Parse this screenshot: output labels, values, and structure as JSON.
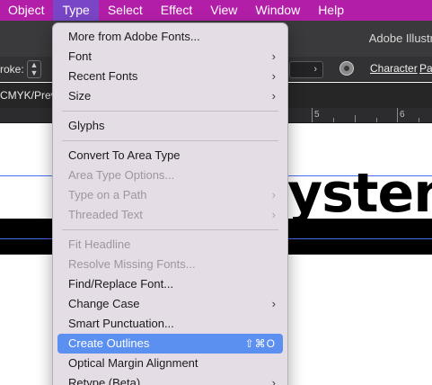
{
  "menubar": {
    "items": [
      "Object",
      "Type",
      "Select",
      "Effect",
      "View",
      "Window",
      "Help"
    ],
    "active_index": 1
  },
  "app": {
    "title": "Adobe Illustr"
  },
  "control_bar": {
    "stroke_label": "roke:",
    "char_link": "Character",
    "par_link": "Par"
  },
  "doc_tab": "CMYK/Previ",
  "ruler": {
    "labels": [
      "5",
      "6"
    ]
  },
  "canvas": {
    "text": "ysten"
  },
  "type_menu": {
    "items": [
      {
        "label": "More from Adobe Fonts...",
        "enabled": true
      },
      {
        "label": "Font",
        "enabled": true,
        "submenu": true
      },
      {
        "label": "Recent Fonts",
        "enabled": true,
        "submenu": true
      },
      {
        "label": "Size",
        "enabled": true,
        "submenu": true
      },
      {
        "separator": true
      },
      {
        "label": "Glyphs",
        "enabled": true
      },
      {
        "separator": true
      },
      {
        "label": "Convert To Area Type",
        "enabled": true
      },
      {
        "label": "Area Type Options...",
        "enabled": false
      },
      {
        "label": "Type on a Path",
        "enabled": false,
        "submenu": true
      },
      {
        "label": "Threaded Text",
        "enabled": false,
        "submenu": true
      },
      {
        "separator": true
      },
      {
        "label": "Fit Headline",
        "enabled": false
      },
      {
        "label": "Resolve Missing Fonts...",
        "enabled": false
      },
      {
        "label": "Find/Replace Font...",
        "enabled": true
      },
      {
        "label": "Change Case",
        "enabled": true,
        "submenu": true
      },
      {
        "label": "Smart Punctuation...",
        "enabled": true
      },
      {
        "label": "Create Outlines",
        "enabled": true,
        "highlighted": true,
        "shortcut": "⇧⌘O"
      },
      {
        "label": "Optical Margin Alignment",
        "enabled": true
      },
      {
        "label": "Retype (Beta)",
        "enabled": true,
        "submenu": true
      }
    ]
  },
  "colors": {
    "menubar": "#b31ea8",
    "menubar_active": "#7a46c8",
    "menu_bg": "#e4dde6",
    "highlight": "#5b8ff0"
  }
}
